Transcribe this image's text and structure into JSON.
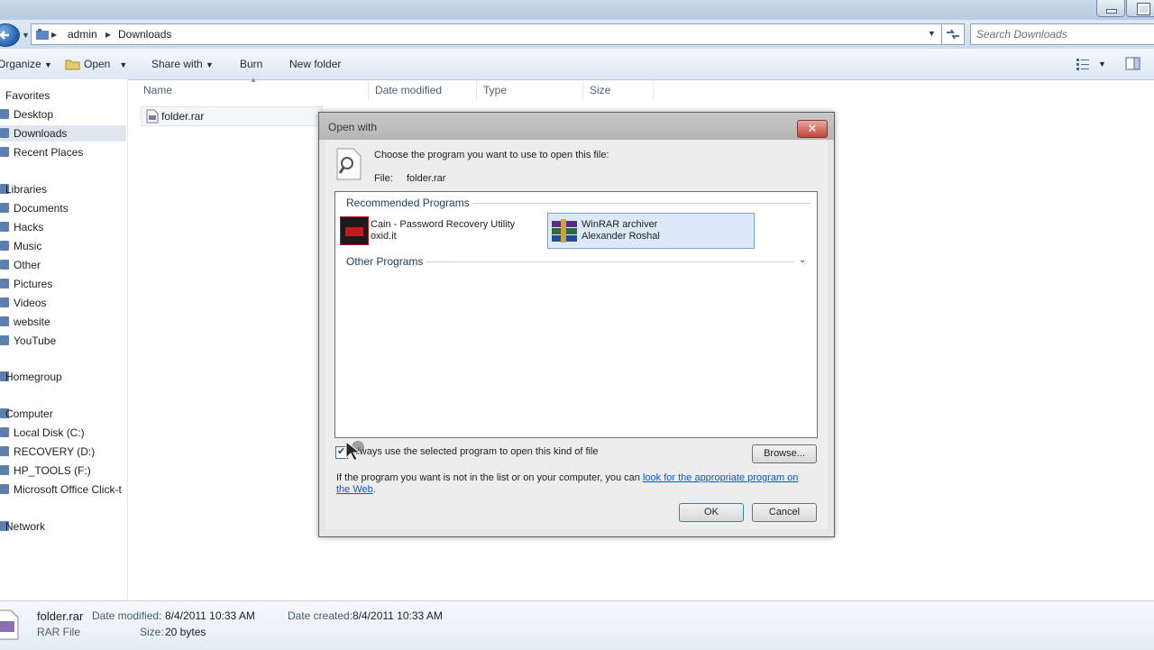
{
  "address": {
    "crumbs": [
      "admin",
      "Downloads"
    ],
    "search_placeholder": "Search Downloads"
  },
  "toolbar": {
    "organize": "Organize",
    "open": "Open",
    "share_with": "Share with",
    "burn": "Burn",
    "new_folder": "New folder"
  },
  "nav": {
    "favorites": "Favorites",
    "favorites_items": [
      "Desktop",
      "Downloads",
      "Recent Places"
    ],
    "libraries": "Libraries",
    "libraries_items": [
      "Documents",
      "Hacks",
      "Music",
      "Other",
      "Pictures",
      "Videos",
      "website",
      "YouTube"
    ],
    "homegroup": "Homegroup",
    "computer": "Computer",
    "computer_items": [
      "Local Disk (C:)",
      "RECOVERY (D:)",
      "HP_TOOLS (F:)",
      "Microsoft Office Click-t"
    ],
    "network": "Network"
  },
  "columns": [
    "Name",
    "Date modified",
    "Type",
    "Size"
  ],
  "files": [
    {
      "name": "folder.rar"
    }
  ],
  "details": {
    "name": "folder.rar",
    "type": "RAR File",
    "date_modified_label": "Date modified:",
    "date_modified": "8/4/2011 10:33 AM",
    "date_created_label": "Date created:",
    "date_created": "8/4/2011 10:33 AM",
    "size_label": "Size:",
    "size": "20 bytes"
  },
  "dialog": {
    "title": "Open with",
    "prompt": "Choose the program you want to use to open this file:",
    "file_label": "File:",
    "file_name": "folder.rar",
    "recommended_label": "Recommended Programs",
    "programs": [
      {
        "name": "Cain - Password Recovery Utility",
        "publisher": "oxid.it"
      },
      {
        "name": "WinRAR archiver",
        "publisher": "Alexander Roshal"
      }
    ],
    "other_label": "Other Programs",
    "always_use": "Always use the selected program to open this kind of file",
    "always_use_checked": true,
    "browse": "Browse...",
    "footer_text": "If the program you want is not in the list or on your computer, you can",
    "footer_link": "look for the appropriate program on the Web",
    "ok": "OK",
    "cancel": "Cancel"
  }
}
